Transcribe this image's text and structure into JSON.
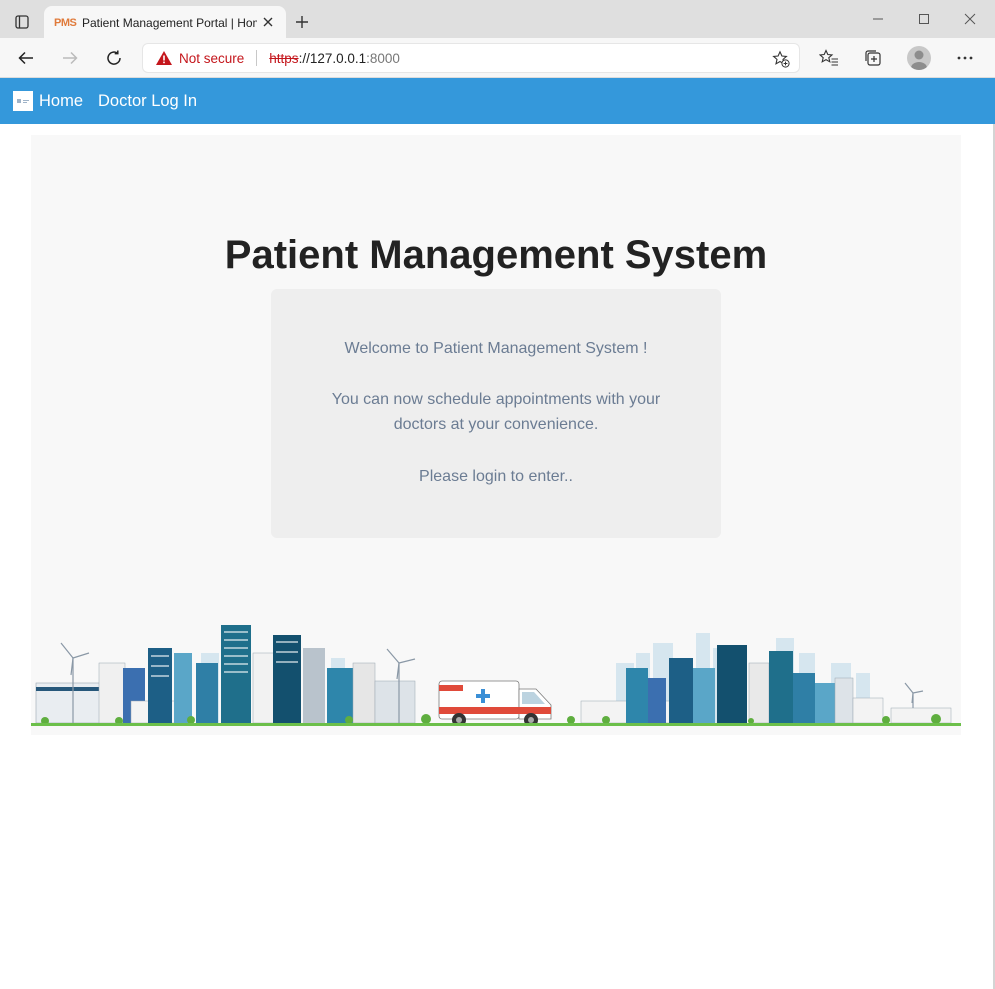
{
  "browser": {
    "tab": {
      "favicon_text": "PMS",
      "title": "Patient Management Portal | Home"
    },
    "address_bar": {
      "security_label": "Not secure",
      "url_scheme": "https",
      "url_sep": "://",
      "url_host": "127.0.0.1",
      "url_port": ":8000"
    },
    "icons": [
      "tab-actions-icon",
      "close-icon",
      "plus-icon",
      "minimize-icon",
      "maximize-icon",
      "window-close-icon",
      "back-arrow-icon",
      "forward-arrow-icon",
      "refresh-icon",
      "warning-icon",
      "add-favorite-icon",
      "favorites-icon",
      "collections-icon",
      "profile-avatar",
      "more-menu-icon"
    ]
  },
  "nav": {
    "home_label": "Home",
    "doctor_login_label": "Doctor Log In",
    "color": "#3498db"
  },
  "hero": {
    "title": "Patient Management System",
    "welcome": "Welcome to Patient Management System !",
    "description_line1": "You can now schedule appointments with your",
    "description_line2": "doctors at your convenience.",
    "login_prompt": "Please login to enter.."
  }
}
